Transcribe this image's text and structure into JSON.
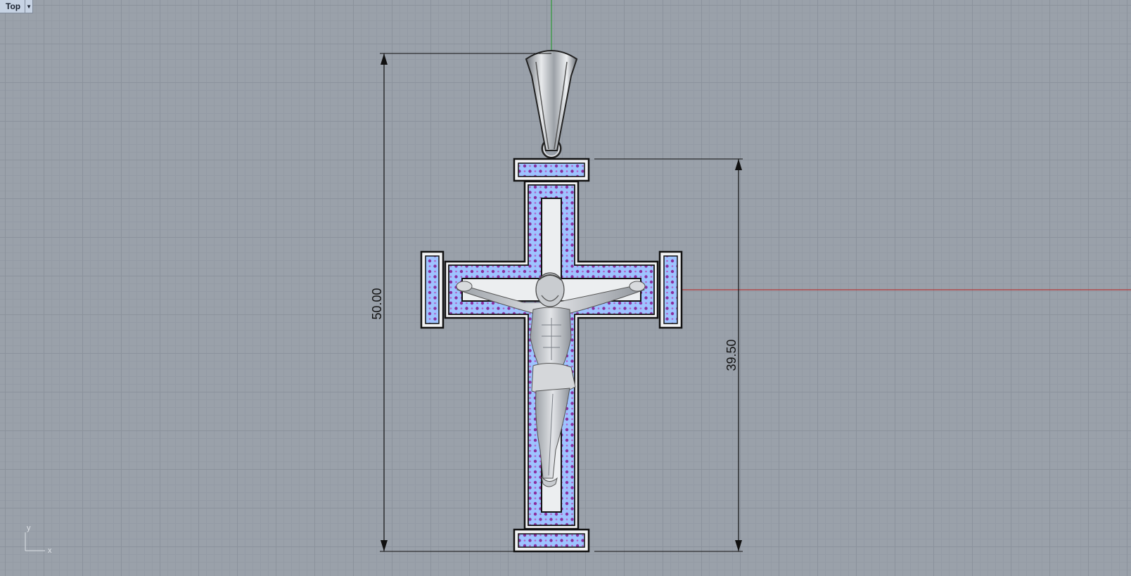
{
  "viewport": {
    "name": "Top",
    "menu_icon": "dropdown-arrow-icon"
  },
  "dimensions": {
    "overall_height": "50.00",
    "cross_height": "39.50"
  },
  "axis_icon": {
    "x_label": "x",
    "y_label": "y"
  },
  "colors": {
    "background": "#9aa1aa",
    "grid": "#8b929c",
    "x_axis": "#b33a3a",
    "y_axis": "#2e9a3a",
    "stone": "#9ec3ff",
    "prong": "#8a2e9e",
    "metal": "#e9ebee"
  }
}
